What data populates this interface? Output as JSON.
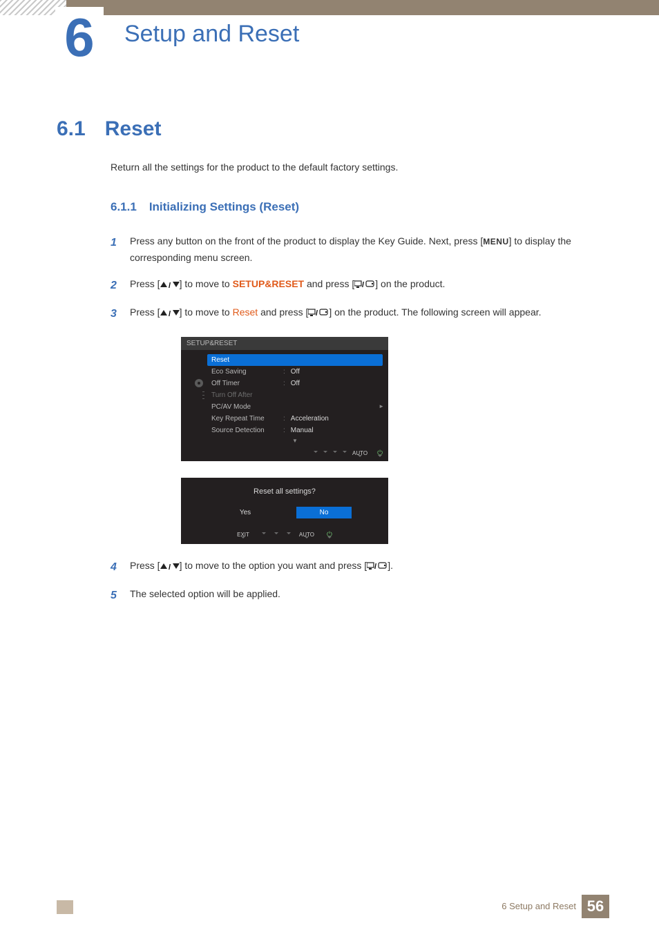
{
  "header": {
    "chapter_number": "6",
    "chapter_title": "Setup and Reset"
  },
  "section": {
    "number": "6.1",
    "title": "Reset",
    "intro": "Return all the settings for the product to the default factory settings."
  },
  "subsection": {
    "number": "6.1.1",
    "title": "Initializing Settings (Reset)"
  },
  "steps": {
    "s1": {
      "num": "1",
      "pre": "Press any button on the front of the product to display the Key Guide. Next, press [",
      "menu": "MENU",
      "post": "] to display the corresponding menu screen."
    },
    "s2": {
      "num": "2",
      "pre": "Press [",
      "mid1": "] to move to ",
      "hl": "SETUP&RESET",
      "mid2": " and press [",
      "post": "] on the product."
    },
    "s3": {
      "num": "3",
      "pre": "Press [",
      "mid1": "] to move to ",
      "hl": "Reset",
      "mid2": " and press [",
      "post": "] on the product. The following screen will appear."
    },
    "s4": {
      "num": "4",
      "pre": "Press [",
      "mid1": "] to move to the option you want and press [",
      "post": "]."
    },
    "s5": {
      "num": "5",
      "text": "The selected option will be applied."
    }
  },
  "osd": {
    "title": "SETUP&RESET",
    "items": [
      {
        "label": "Reset",
        "value": "",
        "selected": true
      },
      {
        "label": "Eco Saving",
        "value": "Off"
      },
      {
        "label": "Off Timer",
        "value": "Off"
      },
      {
        "label": "Turn Off After",
        "value": "",
        "dim": true
      },
      {
        "label": "PC/AV Mode",
        "value": ""
      },
      {
        "label": "Key Repeat Time",
        "value": "Acceleration"
      },
      {
        "label": "Source Detection",
        "value": "Manual"
      }
    ],
    "nav_auto": "AUTO"
  },
  "dialog": {
    "prompt": "Reset all settings?",
    "yes": "Yes",
    "no": "No",
    "exit": "EXIT",
    "auto": "AUTO"
  },
  "footer": {
    "text": "6 Setup and Reset",
    "page": "56"
  }
}
